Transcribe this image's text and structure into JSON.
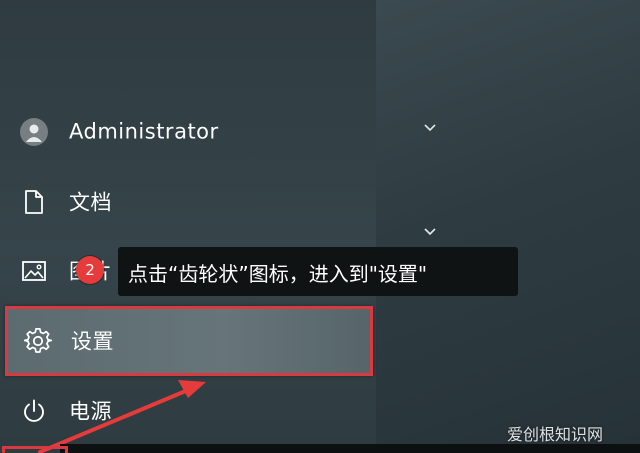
{
  "start_menu": {
    "items": [
      {
        "label": "Administrator",
        "icon": "user-avatar-icon"
      },
      {
        "label": "文档",
        "icon": "document-icon"
      },
      {
        "label": "图片",
        "icon": "image-icon"
      },
      {
        "label": "设置",
        "icon": "gear-icon"
      },
      {
        "label": "电源",
        "icon": "power-icon"
      }
    ]
  },
  "callout": {
    "step": "2",
    "text": "点击“齿轮状”图标，进入到\"设置\""
  },
  "watermark": "爱创根知识网",
  "colors": {
    "highlight": "#d9393f",
    "badge": "#e53b3b",
    "callout_bg": "#0f1314"
  }
}
